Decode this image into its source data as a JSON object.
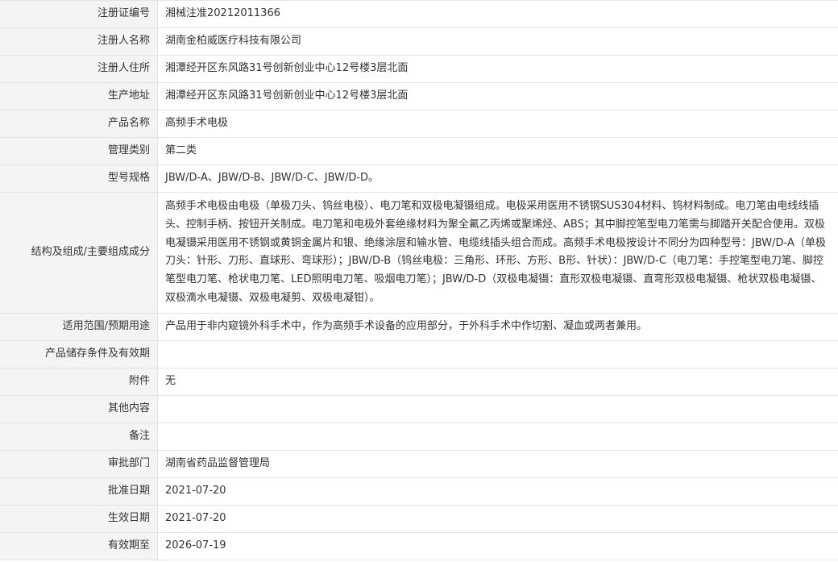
{
  "rows": [
    {
      "label": "注册证编号",
      "value": "湘械注准20212011366"
    },
    {
      "label": "注册人名称",
      "value": "湖南金柏威医疗科技有限公司"
    },
    {
      "label": "注册人住所",
      "value": "湘潭经开区东风路31号创新创业中心12号楼3层北面"
    },
    {
      "label": "生产地址",
      "value": "湘潭经开区东风路31号创新创业中心12号楼3层北面"
    },
    {
      "label": "产品名称",
      "value": "高频手术电极"
    },
    {
      "label": "管理类别",
      "value": "第二类"
    },
    {
      "label": "型号规格",
      "value": "JBW/D-A、JBW/D-B、JBW/D-C、JBW/D-D。"
    },
    {
      "label": "结构及组成/主要组成成分",
      "value": "高频手术电极由电极（单极刀头、钨丝电极）、电刀笔和双极电凝镊组成。电极采用医用不锈钢SUS304材料、钨材料制成。电刀笔由电线线插头、控制手柄、按钮开关制成。电刀笔和电极外套绝缘材料为聚全氟乙丙烯或聚烯烃、ABS；其中脚控笔型电刀笔需与脚踏开关配合使用。双极电凝镊采用医用不锈钢或黄铜金属片和银、绝缘涂层和输水管、电缆线插头组合而成。高频手术电极按设计不同分为四种型号：JBW/D-A（单极刀头：针形、刀形、直球形、弯球形）；JBW/D-B（钨丝电极：三角形、环形、方形、B形、针状）：JBW/D-C（电刀笔：手控笔型电刀笔、脚控笔型电刀笔、枪状电刀笔、LED照明电刀笔、吸烟电刀笔）；JBW/D-D（双极电凝镊：直形双极电凝镊、直弯形双极电凝镊、枪状双极电凝镊、双极滴水电凝镊、双极电凝剪、双极电凝钳）。"
    },
    {
      "label": "适用范围/预期用途",
      "value": "产品用于非内窥镜外科手术中，作为高频手术设备的应用部分，于外科手术中作切割、凝血或两者兼用。"
    },
    {
      "label": "产品储存条件及有效期",
      "value": ""
    },
    {
      "label": "附件",
      "value": "无"
    },
    {
      "label": "其他内容",
      "value": ""
    },
    {
      "label": "备注",
      "value": ""
    },
    {
      "label": "审批部门",
      "value": "湖南省药品监督管理局"
    },
    {
      "label": "批准日期",
      "value": "2021-07-20"
    },
    {
      "label": "生效日期",
      "value": "2021-07-20"
    },
    {
      "label": "有效期至",
      "value": "2026-07-19"
    }
  ]
}
